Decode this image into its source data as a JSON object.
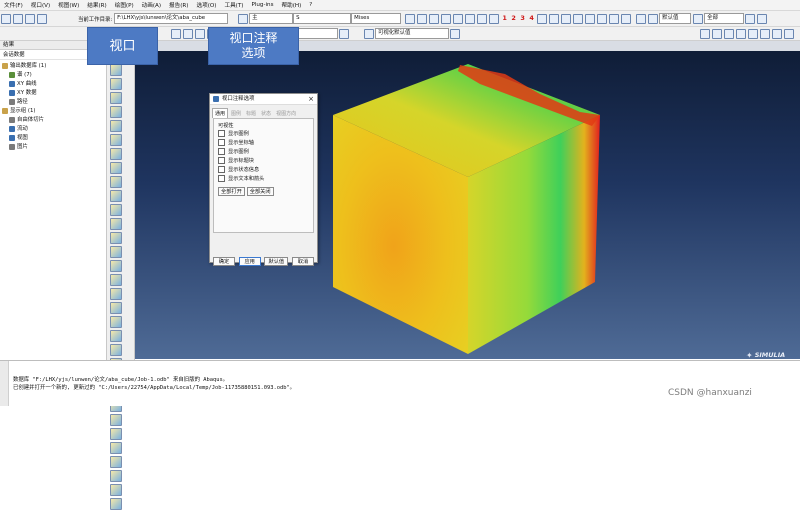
{
  "menu": [
    "文件(F)",
    "视口(V)",
    "视图(W)",
    "结果(R)",
    "绘图(P)",
    "动画(A)",
    "报告(R)",
    "选项(O)",
    "工具(T)",
    "Plug-ins",
    "帮助(H)",
    "?"
  ],
  "toolbar": {
    "work_dir_label": "当前工作目录:",
    "work_dir_value": "F:\\LHX\\yjs\\lunwen\\论文\\aba_cube",
    "primary_label": "主",
    "variable_S": "S",
    "invariant": "Mises",
    "numbers": [
      "1",
      "2",
      "3",
      "4"
    ],
    "all_label": "全部",
    "render_label": "默认值",
    "odb_path": "1735880151.093.odb",
    "visibility_default": "可视化默认值"
  },
  "callouts": {
    "viewport": "视口",
    "annotation_line1": "视口注释",
    "annotation_line2": "选项"
  },
  "left_panel": {
    "tab": "结果",
    "tree_header": "会话数据",
    "items": [
      {
        "label": "输出数据库 (1)",
        "indent": 0,
        "color": "#c9a24a"
      },
      {
        "label": "谱 (7)",
        "indent": 1,
        "color": "#5a8f3a"
      },
      {
        "label": "XY 曲线",
        "indent": 1,
        "color": "#3a6fb0"
      },
      {
        "label": "XY 数据",
        "indent": 1,
        "color": "#3a6fb0"
      },
      {
        "label": "路径",
        "indent": 1,
        "color": "#7a7a7a"
      },
      {
        "label": "显示组 (1)",
        "indent": 0,
        "color": "#c9a24a"
      },
      {
        "label": "自由体切片",
        "indent": 1,
        "color": "#7a7a7a"
      },
      {
        "label": "流动",
        "indent": 1,
        "color": "#3a6fb0"
      },
      {
        "label": "视图",
        "indent": 1,
        "color": "#3a6fb0"
      },
      {
        "label": "图片",
        "indent": 1,
        "color": "#7a7a7a"
      }
    ]
  },
  "dialog": {
    "title": "视口注释选项",
    "tabs": [
      "通用",
      "图例",
      "标题",
      "状态",
      "视图方向"
    ],
    "group_label": "可视性",
    "checks": [
      "显示图例",
      "显示坐标轴",
      "显示图例",
      "显示标题块",
      "显示状态信息",
      "显示文本和箭头"
    ],
    "toggle_on": "全部打开",
    "toggle_off": "全部关闭",
    "buttons": {
      "ok": "确定",
      "apply": "应用",
      "default": "默认值",
      "cancel": "取消"
    }
  },
  "messages": [
    "数据库 \"F:/LHX/yjs/lunwen/论文/aba_cube/Job-1.odb\" 来自旧版的 Abaqus。",
    "已创建并打开一个新的, 更新过的 \"C:/Users/22754/AppData/Local/Temp/Job-11735880151.093.odb\"。"
  ],
  "brand": "SIMULIA",
  "watermark": "CSDN @hanxuanzi"
}
